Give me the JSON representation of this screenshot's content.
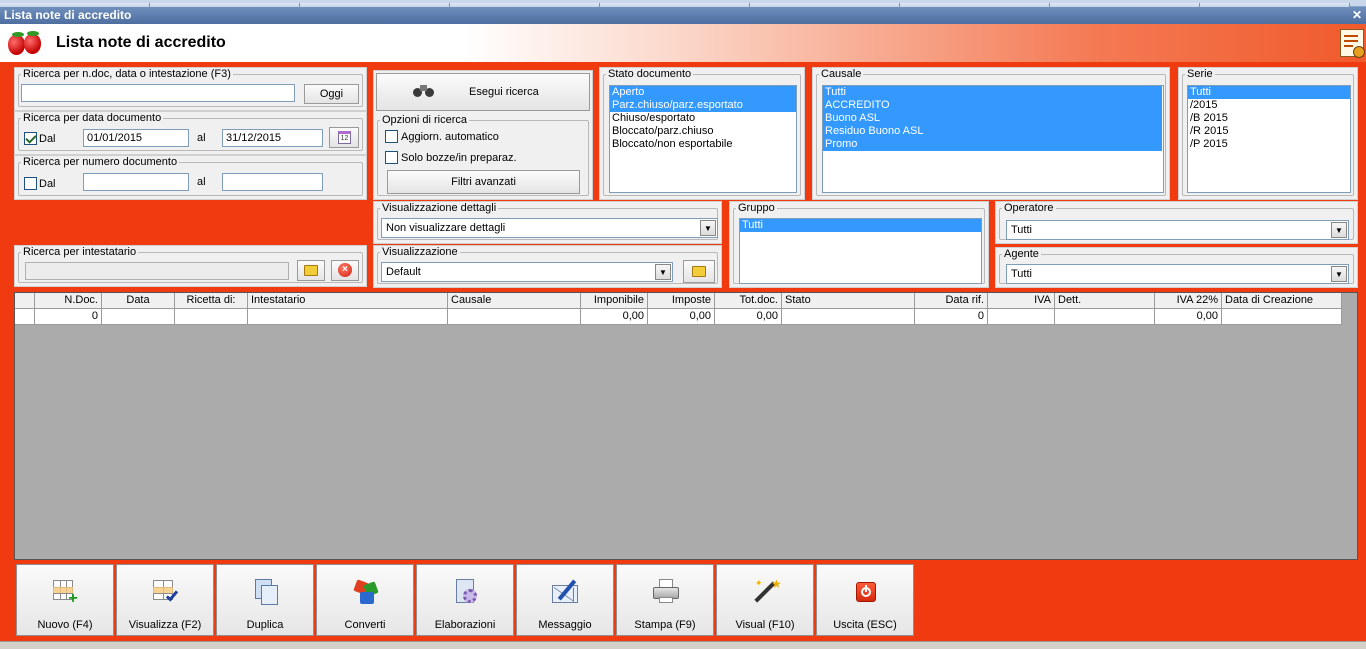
{
  "window": {
    "title": "Lista note di accredito"
  },
  "header": {
    "title": "Lista note di accredito"
  },
  "search_text": {
    "legend": "Ricerca per n.doc, data o intestazione (F3)",
    "value": "",
    "today_label": "Oggi"
  },
  "search_date": {
    "legend": "Ricerca per data documento",
    "from_label": "Dal",
    "from_checked": true,
    "from_value": "01/01/2015",
    "to_label": "al",
    "to_value": "31/12/2015"
  },
  "search_number": {
    "legend": "Ricerca per numero documento",
    "from_label": "Dal",
    "from_checked": false,
    "from_value": "",
    "to_label": "al",
    "to_value": ""
  },
  "search_holder": {
    "legend": "Ricerca per intestatario",
    "value": ""
  },
  "run_search": {
    "label": "Esegui ricerca"
  },
  "search_options": {
    "legend": "Opzioni di ricerca",
    "auto_update_label": "Aggiorn. automatico",
    "drafts_only_label": "Solo bozze/in preparaz.",
    "advanced_filters_label": "Filtri avanzati"
  },
  "document_state": {
    "legend": "Stato documento",
    "items": [
      {
        "label": "Aperto",
        "selected": true
      },
      {
        "label": "Parz.chiuso/parz.esportato",
        "selected": true
      },
      {
        "label": "Chiuso/esportato",
        "selected": false
      },
      {
        "label": "Bloccato/parz.chiuso",
        "selected": false
      },
      {
        "label": "Bloccato/non esportabile",
        "selected": false
      }
    ]
  },
  "causale": {
    "legend": "Causale",
    "items": [
      {
        "label": "Tutti",
        "selected": true
      },
      {
        "label": "ACCREDITO",
        "selected": true
      },
      {
        "label": "Buono ASL",
        "selected": true
      },
      {
        "label": "Residuo Buono ASL",
        "selected": true
      },
      {
        "label": "Promo",
        "selected": true
      }
    ]
  },
  "serie": {
    "legend": "Serie",
    "items": [
      {
        "label": "Tutti",
        "selected": true
      },
      {
        "label": "/2015",
        "selected": false
      },
      {
        "label": "/B 2015",
        "selected": false
      },
      {
        "label": "/R 2015",
        "selected": false
      },
      {
        "label": "/P 2015",
        "selected": false
      }
    ]
  },
  "detail_view": {
    "legend": "Visualizzazione dettagli",
    "value": "Non visualizzare dettagli"
  },
  "view": {
    "legend": "Visualizzazione",
    "value": "Default"
  },
  "group": {
    "legend": "Gruppo",
    "items": [
      {
        "label": "Tutti",
        "selected": true
      }
    ]
  },
  "operator": {
    "legend": "Operatore",
    "value": "Tutti"
  },
  "agent": {
    "legend": "Agente",
    "value": "Tutti"
  },
  "table": {
    "columns": [
      "",
      "N.Doc.",
      "Data",
      "Ricetta di:",
      "Intestatario",
      "Causale",
      "Imponibile",
      "Imposte",
      "Tot.doc.",
      "Stato",
      "Data rif.",
      "IVA",
      "Dett.",
      "IVA 22%",
      "Data di Creazione"
    ],
    "totals": [
      "",
      "0",
      "",
      "",
      "",
      "",
      "0,00",
      "0,00",
      "0,00",
      "",
      "0",
      "",
      "",
      "0,00",
      ""
    ]
  },
  "toolbar": [
    {
      "label": "Nuovo (F4)",
      "icon": "grid-add-icon"
    },
    {
      "label": "Visualizza (F2)",
      "icon": "grid-check-icon"
    },
    {
      "label": "Duplica",
      "icon": "duplicate-icon"
    },
    {
      "label": "Converti",
      "icon": "convert-arrows-icon"
    },
    {
      "label": "Elaborazioni",
      "icon": "gear-document-icon"
    },
    {
      "label": "Messaggio",
      "icon": "envelope-pen-icon"
    },
    {
      "label": "Stampa (F9)",
      "icon": "printer-icon"
    },
    {
      "label": "Visual (F10)",
      "icon": "magic-wand-icon"
    },
    {
      "label": "Uscita (ESC)",
      "icon": "power-icon"
    }
  ],
  "colors": {
    "background": "#f03a10",
    "selection": "#3399ff",
    "title_bar": "#5b7db0"
  }
}
